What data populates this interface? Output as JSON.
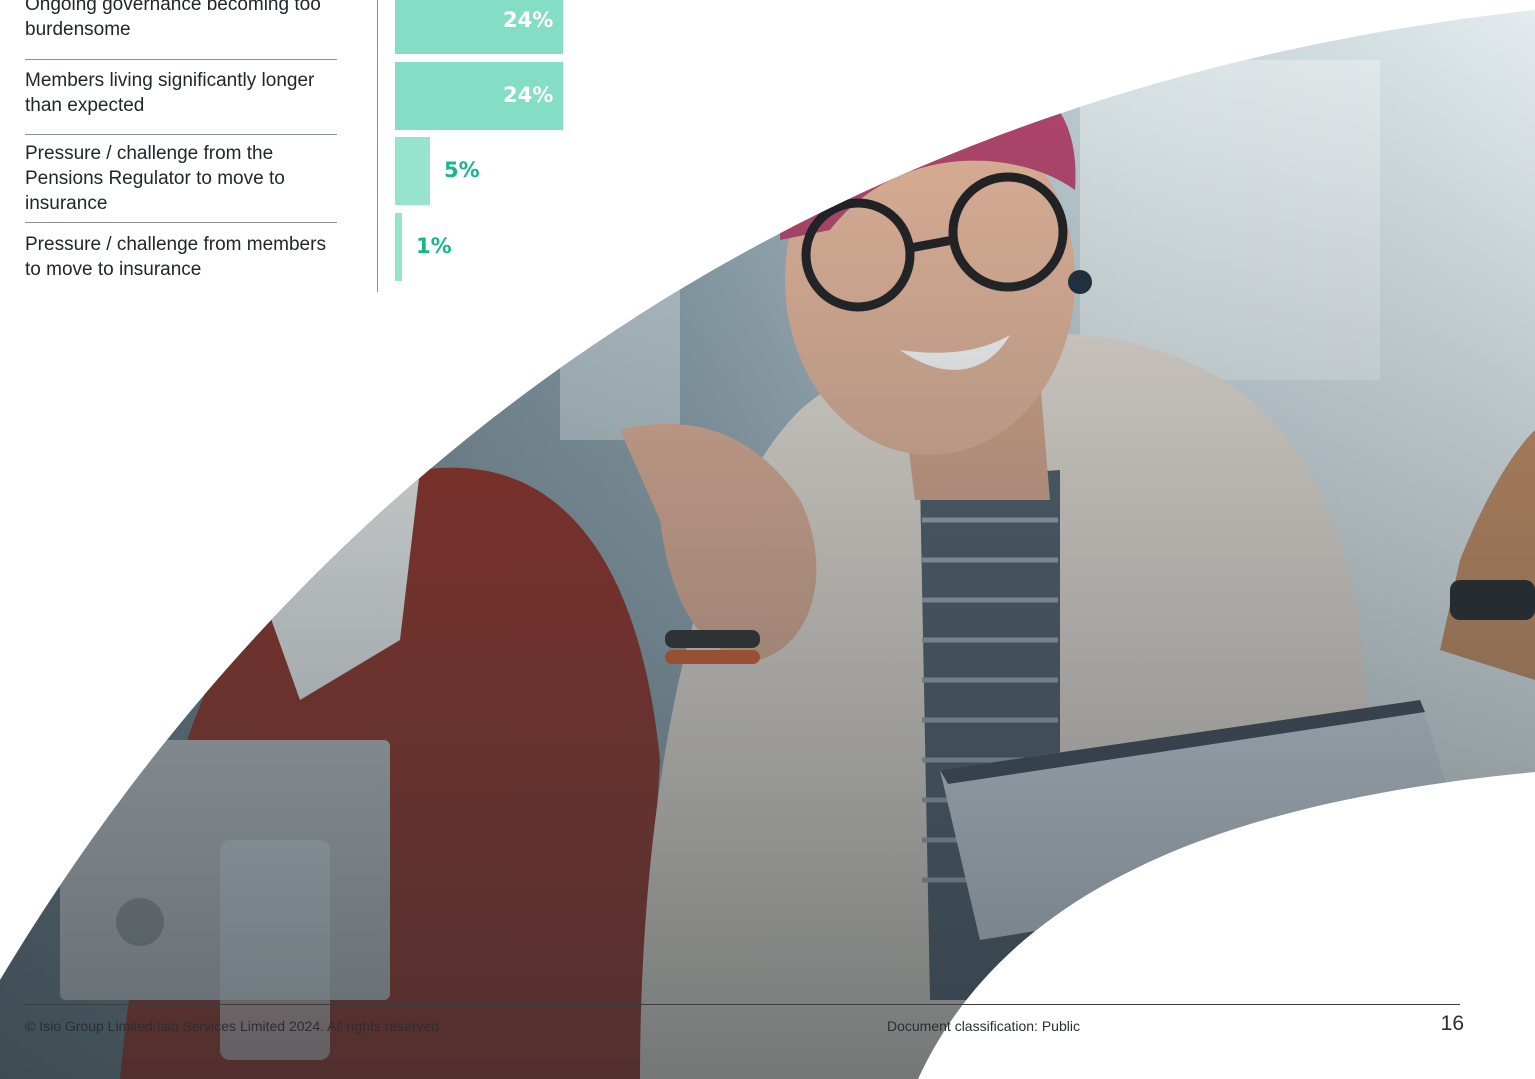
{
  "chart_data": {
    "type": "bar",
    "orientation": "horizontal",
    "categories": [
      "Ongoing governance becoming too burdensome",
      "Members living significantly longer than expected",
      "Pressure / challenge from the Pensions Regulator to move to insurance",
      "Pressure / challenge from members to move to insurance"
    ],
    "values": [
      24,
      24,
      5,
      1
    ],
    "value_labels": [
      "24%",
      "24%",
      "5%",
      "1%"
    ],
    "unit": "%"
  },
  "labels": {
    "row1": "Ongoing governance becoming too burdensome",
    "row2": "Members living significantly longer than expected",
    "row3": "Pressure / challenge from the Pensions Regulator to move to insurance",
    "row4": "Pressure / challenge from members to move to insurance"
  },
  "colors": {
    "bar": "#84dec6",
    "value_outside": "#16b88b",
    "value_inside": "#ffffff"
  },
  "footer": {
    "copyright": "© Isio Group Limited/Isio Services Limited 2024. All rights reserved",
    "classification": "Document classification: Public",
    "page_number": "16"
  }
}
